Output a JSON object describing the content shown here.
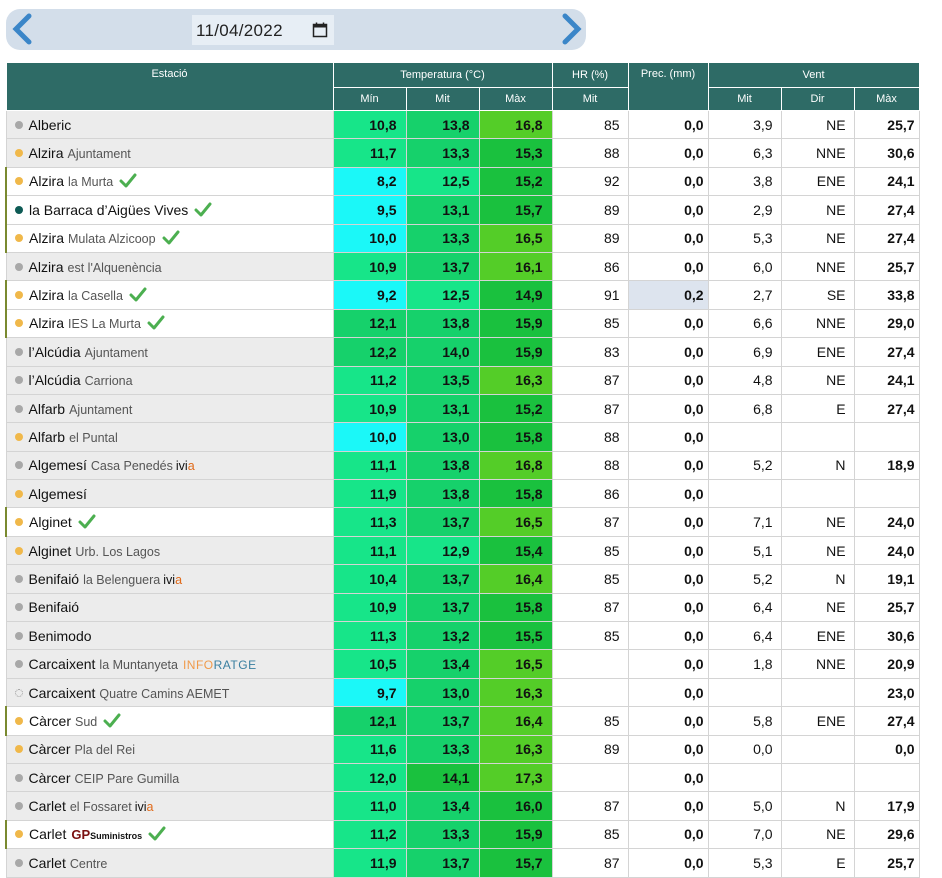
{
  "date": "11/04/2022",
  "icons": {
    "prev": "chevron-left-icon",
    "next": "chevron-right-icon",
    "calendar": "calendar-icon",
    "check": "checkmark-icon",
    "status": "status-dot-icon"
  },
  "headers": {
    "station": "Estació",
    "temp": "Temperatura (°C)",
    "hr": "HR (%)",
    "prec": "Prec. (mm)",
    "wind": "Vent",
    "min": "Mín",
    "mit": "Mit",
    "max": "Màx",
    "hr_mit": "Mit",
    "wind_mit": "Mit",
    "wind_dir": "Dir",
    "wind_max": "Màx"
  },
  "colors": {
    "header": "#2e6b66",
    "dot_orange": "#f0b84a",
    "dot_gray": "#a8a8a8",
    "dot_teal": "#0e5b55",
    "check": "#4caf50",
    "prec_highlight": "#dde4ee"
  },
  "rows": [
    {
      "name": "Alberic",
      "sub": "",
      "badge": "",
      "dot": "gray",
      "check": false,
      "white": false,
      "min": "10,8",
      "mit": "13,8",
      "max": "16,8",
      "hr": "85",
      "prec": "0,0",
      "wmit": "3,9",
      "wdir": "NE",
      "wmax": "25,7",
      "minc": "#17e589",
      "mitc": "#16d16b",
      "maxc": "#54cd28"
    },
    {
      "name": "Alzira",
      "sub": "Ajuntament",
      "badge": "",
      "dot": "orange",
      "check": false,
      "white": false,
      "min": "11,7",
      "mit": "13,3",
      "max": "15,3",
      "hr": "88",
      "prec": "0,0",
      "wmit": "6,3",
      "wdir": "NNE",
      "wmax": "30,6",
      "minc": "#17e589",
      "mitc": "#16d16b",
      "maxc": "#1ac13e"
    },
    {
      "name": "Alzira",
      "sub": "la Murta",
      "badge": "",
      "dot": "orange",
      "check": true,
      "white": true,
      "min": "8,2",
      "mit": "12,5",
      "max": "15,2",
      "hr": "92",
      "prec": "0,0",
      "wmit": "3,8",
      "wdir": "ENE",
      "wmax": "24,1",
      "minc": "#1bf8f8",
      "mitc": "#17e589",
      "maxc": "#1ac13e"
    },
    {
      "name": "la Barraca d’Aigües Vives",
      "sub": "",
      "badge": "",
      "dot": "teal",
      "check": true,
      "white": true,
      "min": "9,5",
      "mit": "13,1",
      "max": "15,7",
      "hr": "89",
      "prec": "0,0",
      "wmit": "2,9",
      "wdir": "NE",
      "wmax": "27,4",
      "minc": "#1bf8f8",
      "mitc": "#16d16b",
      "maxc": "#1ac13e"
    },
    {
      "name": "Alzira",
      "sub": "Mulata Alzicoop",
      "badge": "",
      "dot": "orange",
      "check": true,
      "white": true,
      "min": "10,0",
      "mit": "13,3",
      "max": "16,5",
      "hr": "89",
      "prec": "0,0",
      "wmit": "5,3",
      "wdir": "NE",
      "wmax": "27,4",
      "minc": "#1bf8f8",
      "mitc": "#16d16b",
      "maxc": "#54cd28"
    },
    {
      "name": "Alzira",
      "sub": "est l'Alquenència",
      "badge": "",
      "dot": "gray",
      "check": false,
      "white": false,
      "min": "10,9",
      "mit": "13,7",
      "max": "16,1",
      "hr": "86",
      "prec": "0,0",
      "wmit": "6,0",
      "wdir": "NNE",
      "wmax": "25,7",
      "minc": "#17e589",
      "mitc": "#16d16b",
      "maxc": "#54cd28"
    },
    {
      "name": "Alzira",
      "sub": "la Casella",
      "badge": "",
      "dot": "orange",
      "check": true,
      "white": true,
      "min": "9,2",
      "mit": "12,5",
      "max": "14,9",
      "hr": "91",
      "prec": "0,2",
      "wmit": "2,7",
      "wdir": "SE",
      "wmax": "33,8",
      "minc": "#1bf8f8",
      "mitc": "#17e589",
      "maxc": "#1ac13e",
      "hl": true
    },
    {
      "name": "Alzira",
      "sub": "IES La Murta",
      "badge": "",
      "dot": "orange",
      "check": true,
      "white": true,
      "min": "12,1",
      "mit": "13,8",
      "max": "15,9",
      "hr": "85",
      "prec": "0,0",
      "wmit": "6,6",
      "wdir": "NNE",
      "wmax": "29,0",
      "minc": "#16d16b",
      "mitc": "#16d16b",
      "maxc": "#1ac13e"
    },
    {
      "name": "l’Alcúdia",
      "sub": "Ajuntament",
      "badge": "",
      "dot": "gray",
      "check": false,
      "white": false,
      "min": "12,2",
      "mit": "14,0",
      "max": "15,9",
      "hr": "83",
      "prec": "0,0",
      "wmit": "6,9",
      "wdir": "ENE",
      "wmax": "27,4",
      "minc": "#16d16b",
      "mitc": "#16d16b",
      "maxc": "#1ac13e"
    },
    {
      "name": "l’Alcúdia",
      "sub": "Carriona",
      "badge": "",
      "dot": "gray",
      "check": false,
      "white": false,
      "min": "11,2",
      "mit": "13,5",
      "max": "16,3",
      "hr": "87",
      "prec": "0,0",
      "wmit": "4,8",
      "wdir": "NE",
      "wmax": "24,1",
      "minc": "#17e589",
      "mitc": "#16d16b",
      "maxc": "#54cd28"
    },
    {
      "name": "Alfarb",
      "sub": "Ajuntament",
      "badge": "",
      "dot": "gray",
      "check": false,
      "white": false,
      "min": "10,9",
      "mit": "13,1",
      "max": "15,2",
      "hr": "87",
      "prec": "0,0",
      "wmit": "6,8",
      "wdir": "E",
      "wmax": "27,4",
      "minc": "#17e589",
      "mitc": "#16d16b",
      "maxc": "#1ac13e"
    },
    {
      "name": "Alfarb",
      "sub": "el Puntal",
      "badge": "",
      "dot": "orange",
      "check": false,
      "white": false,
      "min": "10,0",
      "mit": "13,0",
      "max": "15,8",
      "hr": "88",
      "prec": "0,0",
      "wmit": "",
      "wdir": "",
      "wmax": "",
      "minc": "#1bf8f8",
      "mitc": "#16d16b",
      "maxc": "#1ac13e"
    },
    {
      "name": "Algemesí",
      "sub": "Casa Penedés",
      "badge": "ivia",
      "dot": "gray",
      "check": false,
      "white": false,
      "min": "11,1",
      "mit": "13,8",
      "max": "16,8",
      "hr": "88",
      "prec": "0,0",
      "wmit": "5,2",
      "wdir": "N",
      "wmax": "18,9",
      "minc": "#17e589",
      "mitc": "#16d16b",
      "maxc": "#54cd28"
    },
    {
      "name": "Algemesí",
      "sub": "",
      "badge": "",
      "dot": "orange",
      "check": false,
      "white": false,
      "min": "11,9",
      "mit": "13,8",
      "max": "15,8",
      "hr": "86",
      "prec": "0,0",
      "wmit": "",
      "wdir": "",
      "wmax": "",
      "minc": "#17e589",
      "mitc": "#16d16b",
      "maxc": "#1ac13e"
    },
    {
      "name": "Alginet",
      "sub": "",
      "badge": "",
      "dot": "orange",
      "check": true,
      "white": true,
      "min": "11,3",
      "mit": "13,7",
      "max": "16,5",
      "hr": "87",
      "prec": "0,0",
      "wmit": "7,1",
      "wdir": "NE",
      "wmax": "24,0",
      "minc": "#17e589",
      "mitc": "#16d16b",
      "maxc": "#54cd28"
    },
    {
      "name": "Alginet",
      "sub": "Urb. Los Lagos",
      "badge": "",
      "dot": "orange",
      "check": false,
      "white": false,
      "min": "11,1",
      "mit": "12,9",
      "max": "15,4",
      "hr": "85",
      "prec": "0,0",
      "wmit": "5,1",
      "wdir": "NE",
      "wmax": "24,0",
      "minc": "#17e589",
      "mitc": "#17e589",
      "maxc": "#1ac13e"
    },
    {
      "name": "Benifaió",
      "sub": "la Belenguera",
      "badge": "ivia",
      "dot": "gray",
      "check": false,
      "white": false,
      "min": "10,4",
      "mit": "13,7",
      "max": "16,4",
      "hr": "85",
      "prec": "0,0",
      "wmit": "5,2",
      "wdir": "N",
      "wmax": "19,1",
      "minc": "#17e589",
      "mitc": "#16d16b",
      "maxc": "#54cd28"
    },
    {
      "name": "Benifaió",
      "sub": "",
      "badge": "",
      "dot": "gray",
      "check": false,
      "white": false,
      "min": "10,9",
      "mit": "13,7",
      "max": "15,8",
      "hr": "87",
      "prec": "0,0",
      "wmit": "6,4",
      "wdir": "NE",
      "wmax": "25,7",
      "minc": "#17e589",
      "mitc": "#16d16b",
      "maxc": "#1ac13e"
    },
    {
      "name": "Benimodo",
      "sub": "",
      "badge": "",
      "dot": "gray",
      "check": false,
      "white": false,
      "min": "11,3",
      "mit": "13,2",
      "max": "15,5",
      "hr": "85",
      "prec": "0,0",
      "wmit": "6,4",
      "wdir": "ENE",
      "wmax": "30,6",
      "minc": "#17e589",
      "mitc": "#16d16b",
      "maxc": "#1ac13e"
    },
    {
      "name": "Carcaixent",
      "sub": "la Muntanyeta",
      "badge": "inforatge",
      "dot": "gray",
      "check": false,
      "white": false,
      "min": "10,5",
      "mit": "13,4",
      "max": "16,5",
      "hr": "",
      "prec": "0,0",
      "wmit": "1,8",
      "wdir": "NNE",
      "wmax": "20,9",
      "minc": "#17e589",
      "mitc": "#16d16b",
      "maxc": "#54cd28"
    },
    {
      "name": "Carcaixent",
      "sub": "Quatre Camins AEMET",
      "badge": "",
      "dot": "hollow",
      "check": false,
      "white": false,
      "min": "9,7",
      "mit": "13,0",
      "max": "16,3",
      "hr": "",
      "prec": "0,0",
      "wmit": "",
      "wdir": "",
      "wmax": "23,0",
      "minc": "#1bf8f8",
      "mitc": "#16d16b",
      "maxc": "#54cd28"
    },
    {
      "name": "Càrcer",
      "sub": "Sud",
      "badge": "",
      "dot": "orange",
      "check": true,
      "white": true,
      "min": "12,1",
      "mit": "13,7",
      "max": "16,4",
      "hr": "85",
      "prec": "0,0",
      "wmit": "5,8",
      "wdir": "ENE",
      "wmax": "27,4",
      "minc": "#16d16b",
      "mitc": "#16d16b",
      "maxc": "#54cd28"
    },
    {
      "name": "Càrcer",
      "sub": "Pla del Rei",
      "badge": "",
      "dot": "orange",
      "check": false,
      "white": false,
      "min": "11,6",
      "mit": "13,3",
      "max": "16,3",
      "hr": "89",
      "prec": "0,0",
      "wmit": "0,0",
      "wdir": "",
      "wmax": "0,0",
      "minc": "#17e589",
      "mitc": "#16d16b",
      "maxc": "#54cd28"
    },
    {
      "name": "Càrcer",
      "sub": "CEIP Pare Gumilla",
      "badge": "",
      "dot": "gray",
      "check": false,
      "white": false,
      "min": "12,0",
      "mit": "14,1",
      "max": "17,3",
      "hr": "",
      "prec": "0,0",
      "wmit": "",
      "wdir": "",
      "wmax": "",
      "minc": "#17e589",
      "mitc": "#1ac13e",
      "maxc": "#54cd28"
    },
    {
      "name": "Carlet",
      "sub": "el Fossaret",
      "badge": "ivia",
      "dot": "gray",
      "check": false,
      "white": false,
      "min": "11,0",
      "mit": "13,4",
      "max": "16,0",
      "hr": "87",
      "prec": "0,0",
      "wmit": "5,0",
      "wdir": "N",
      "wmax": "17,9",
      "minc": "#17e589",
      "mitc": "#16d16b",
      "maxc": "#1ac13e"
    },
    {
      "name": "Carlet",
      "sub": "",
      "badge": "gp",
      "dot": "orange",
      "check": true,
      "white": true,
      "min": "11,2",
      "mit": "13,3",
      "max": "15,9",
      "hr": "85",
      "prec": "0,0",
      "wmit": "7,0",
      "wdir": "NE",
      "wmax": "29,6",
      "minc": "#17e589",
      "mitc": "#16d16b",
      "maxc": "#1ac13e"
    },
    {
      "name": "Carlet",
      "sub": "Centre",
      "badge": "",
      "dot": "gray",
      "check": false,
      "white": false,
      "min": "11,9",
      "mit": "13,7",
      "max": "15,7",
      "hr": "87",
      "prec": "0,0",
      "wmit": "5,3",
      "wdir": "E",
      "wmax": "25,7",
      "minc": "#17e589",
      "mitc": "#16d16b",
      "maxc": "#1ac13e"
    }
  ],
  "badges": {
    "ivia": [
      "ivi",
      "a"
    ],
    "inforatge": [
      "INFO",
      "RATGE"
    ],
    "gp": [
      "GP",
      "Suministros"
    ]
  }
}
